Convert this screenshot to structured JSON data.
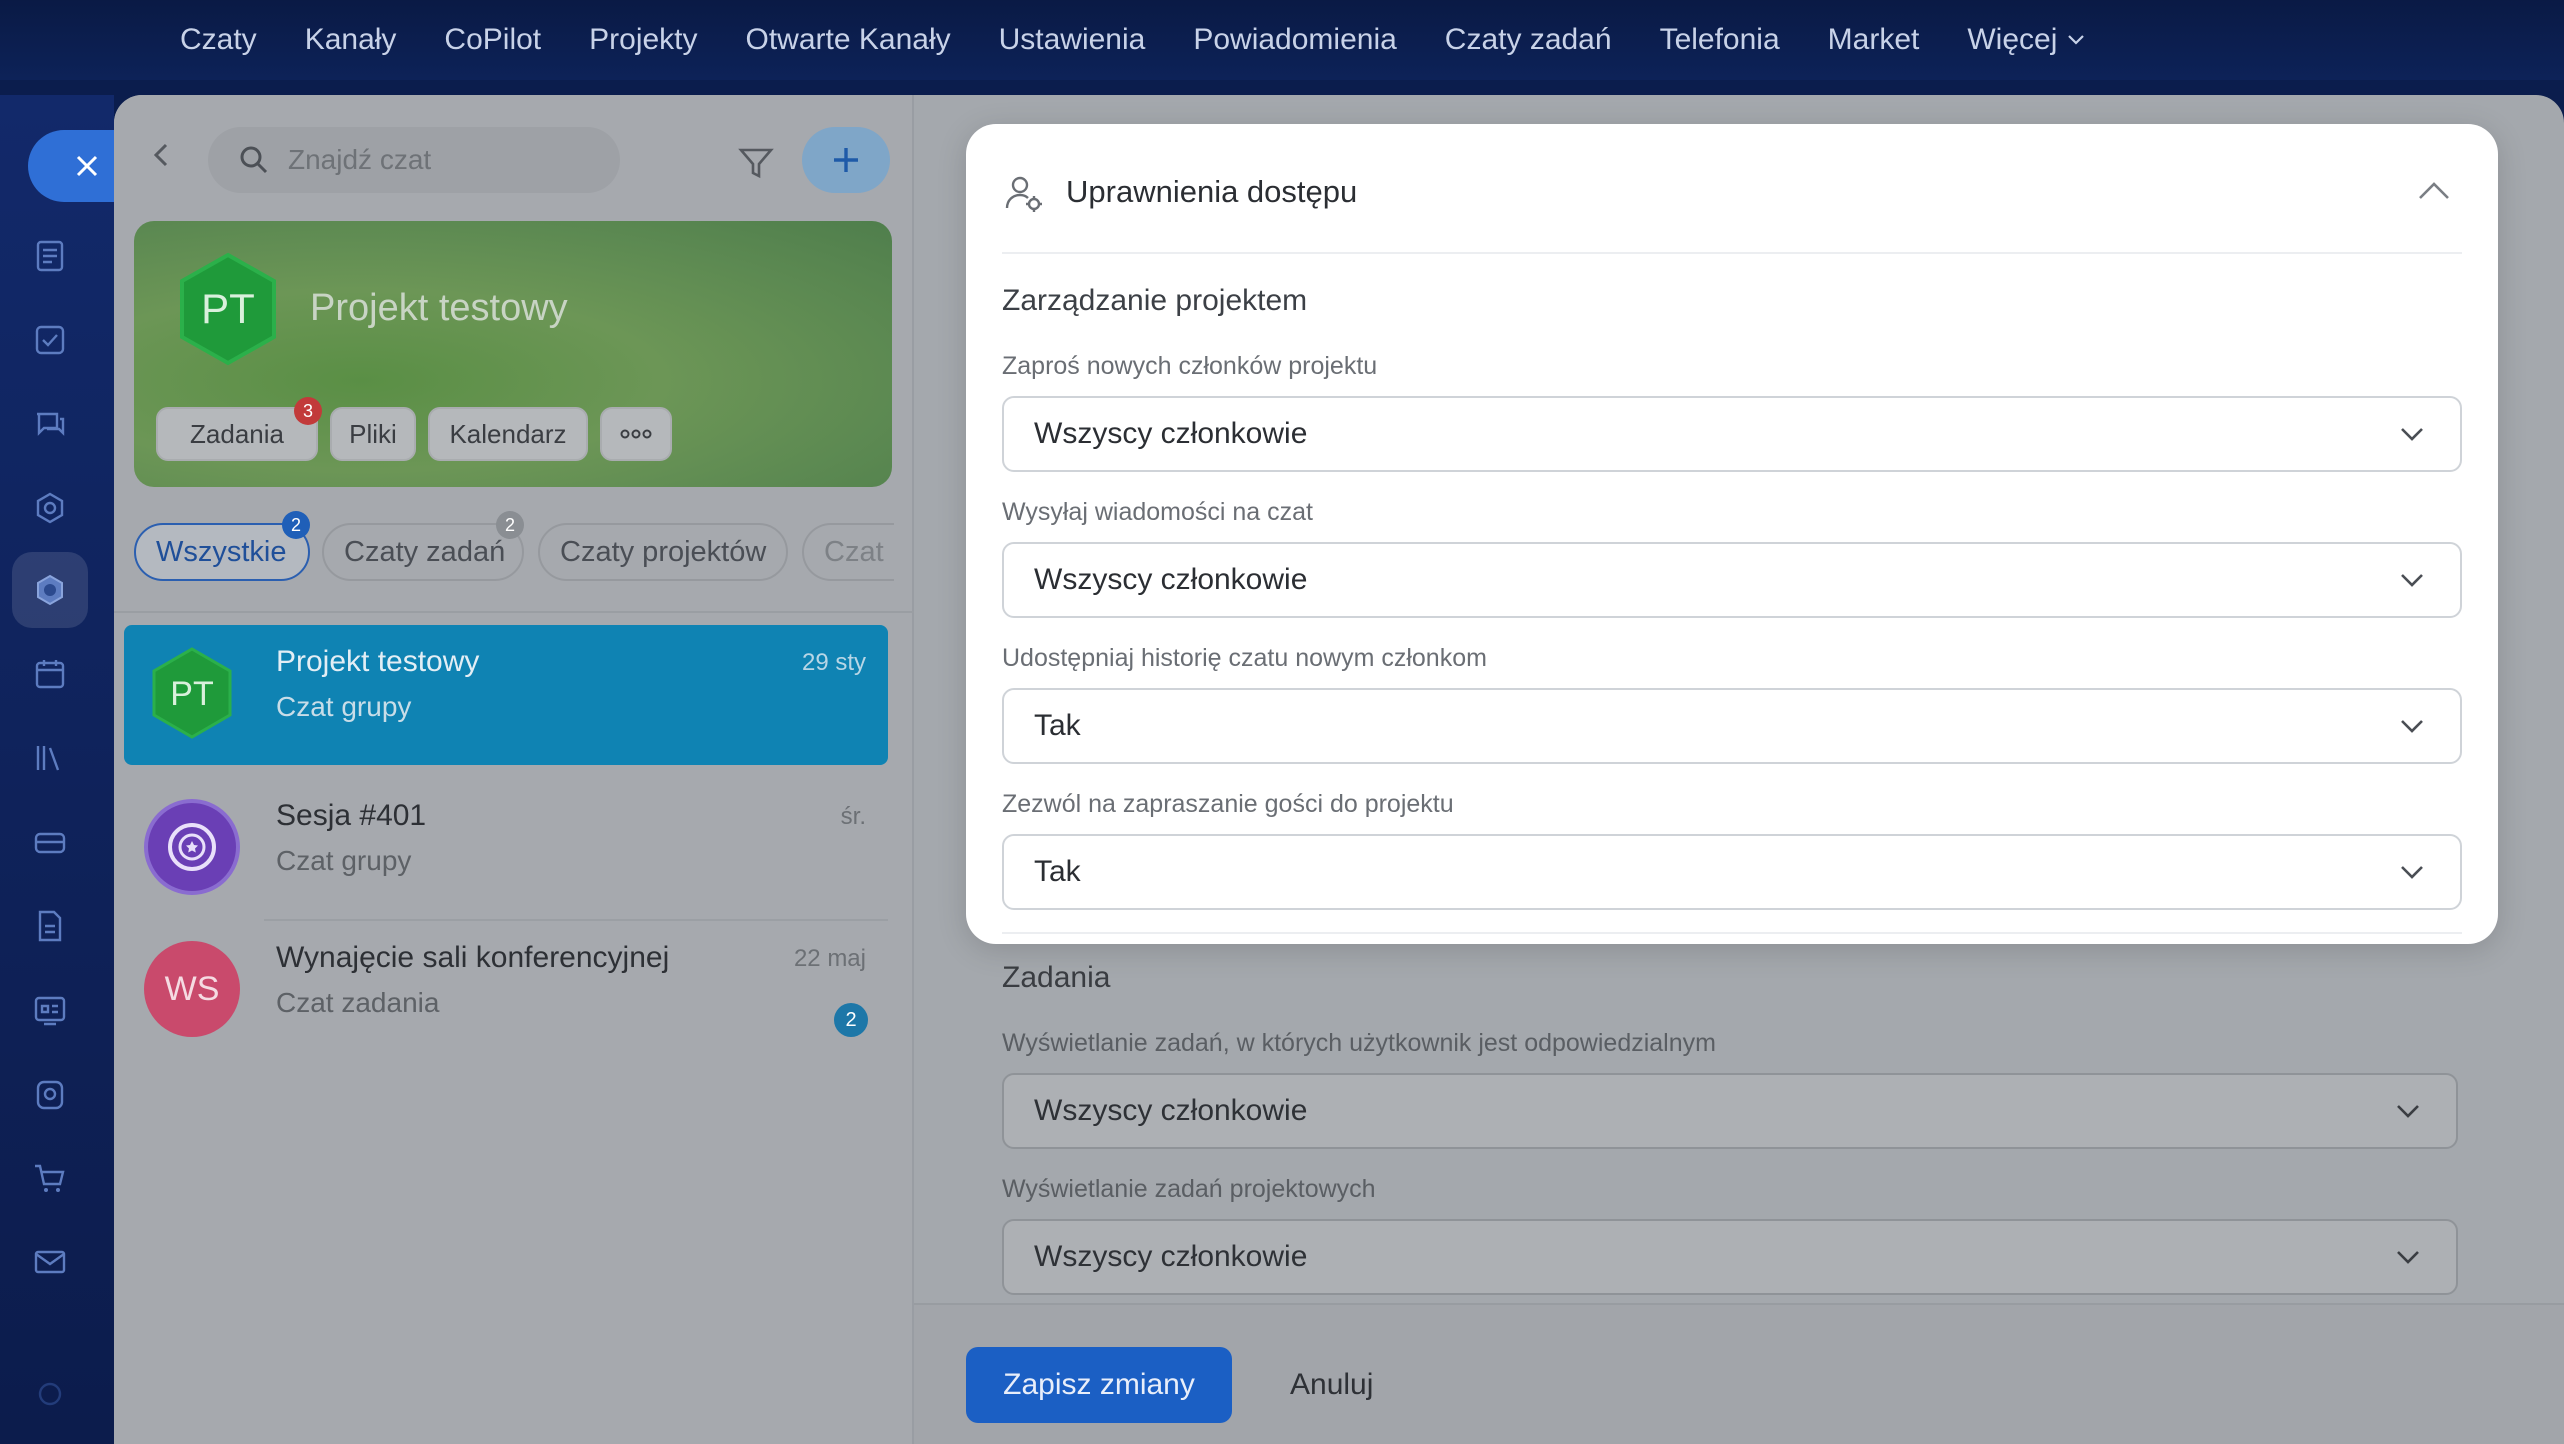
{
  "topnav": {
    "items": [
      "Czaty",
      "Kanały",
      "CoPilot",
      "Projekty",
      "Otwarte Kanały",
      "Ustawienia",
      "Powiadomienia",
      "Czaty zadań",
      "Telefonia",
      "Market"
    ],
    "more_label": "Więcej"
  },
  "sidebar": {
    "search_placeholder": "Znajdź czat",
    "banner": {
      "initials": "PT",
      "title": "Projekt testowy",
      "chips": [
        {
          "label": "Zadania",
          "badge": "3"
        },
        {
          "label": "Pliki"
        },
        {
          "label": "Kalendarz"
        },
        {
          "label": "ooo"
        }
      ]
    },
    "filters": [
      {
        "label": "Wszystkie",
        "badge": "2"
      },
      {
        "label": "Czaty zadań",
        "badge": "2"
      },
      {
        "label": "Czaty projektów"
      },
      {
        "label": "Czat"
      }
    ],
    "chats": [
      {
        "initials": "PT",
        "name": "Projekt testowy",
        "sub": "Czat grupy",
        "date": "29 sty"
      },
      {
        "initials": "",
        "name": "Sesja #401",
        "sub": "Czat grupy",
        "date": "śr."
      },
      {
        "initials": "WS",
        "name": "Wynajęcie sali konferencyjnej",
        "sub": "Czat zadania",
        "date": "22 maj",
        "unread": "2"
      }
    ]
  },
  "modal": {
    "title": "Uprawnienia dostępu",
    "section": "Zarządzanie projektem",
    "fields": [
      {
        "label": "Zaproś nowych członków projektu",
        "value": "Wszyscy członkowie"
      },
      {
        "label": "Wysyłaj wiadomości na czat",
        "value": "Wszyscy członkowie"
      },
      {
        "label": "Udostępniaj historię czatu nowym członkom",
        "value": "Tak"
      },
      {
        "label": "Zezwól na zapraszanie gości do projektu",
        "value": "Tak"
      }
    ]
  },
  "tasks": {
    "section": "Zadania",
    "fields": [
      {
        "label": "Wyświetlanie zadań, w których użytkownik jest odpowiedzialnym",
        "value": "Wszyscy członkowie"
      },
      {
        "label": "Wyświetlanie zadań projektowych",
        "value": "Wszyscy członkowie"
      }
    ]
  },
  "footer": {
    "save_label": "Zapisz zmiany",
    "cancel_label": "Anuluj"
  },
  "colors": {
    "accent": "#1b5fc4",
    "selected_chat": "#0f83b3",
    "badge_red": "#c23a3a",
    "project_green": "#1f9a3a",
    "avatar_pink": "#d94f78",
    "avatar_purple": "#6a3fb5"
  }
}
